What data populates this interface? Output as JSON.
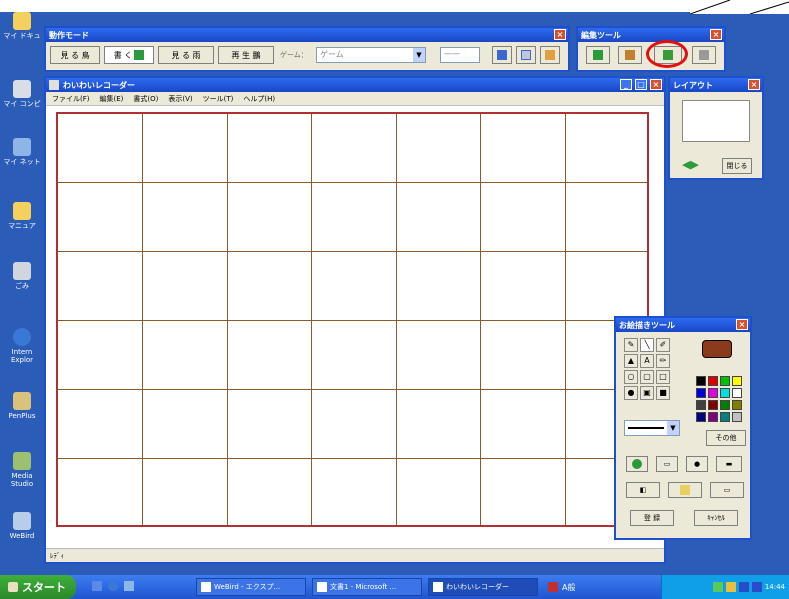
{
  "desktop": {
    "icons": [
      {
        "label": "マイ ドキュ",
        "color": "#f3d15c"
      },
      {
        "label": "マイ コンピ",
        "color": "#d9dde8"
      },
      {
        "label": "マイ ネット",
        "color": "#8fb4e6"
      },
      {
        "label": "マニュア",
        "color": "#f3d15c"
      },
      {
        "label": "ごみ",
        "color": "#cfd6de"
      },
      {
        "label": "Intern Explor",
        "color": "#3a78d8"
      },
      {
        "label": "PenPlus",
        "color": "#d9c27a"
      },
      {
        "label": "Media Studio",
        "color": "#9cc070"
      },
      {
        "label": "WeBird",
        "color": "#b8cde8"
      }
    ]
  },
  "mode_toolbar": {
    "title": "動作モード",
    "buttons": [
      "見 る 鳥",
      "書 く",
      "見 る 雨",
      "再 生 鵬"
    ],
    "game_label": "ゲーム：",
    "game_combo_value": "ゲーム",
    "small_combo_value": "一一",
    "icon_buttons": [
      "film-icon",
      "grid-icon",
      "user-icon"
    ]
  },
  "edit_tools": {
    "title": "編集ツール",
    "buttons": [
      "tree-icon",
      "stamp-icon",
      "paint-icon",
      "copy-icon"
    ]
  },
  "main_window": {
    "title": "わいわいレコーダー",
    "menu": [
      "ファイル(F)",
      "編集(E)",
      "書式(O)",
      "表示(V)",
      "ツール(T)",
      "ヘルプ(H)"
    ],
    "status": "ﾚﾃﾞｨ"
  },
  "preview_panel": {
    "title": "レイアウト",
    "close_label": "閉じる"
  },
  "paint_tools": {
    "title": "お絵描きツール",
    "more_colors_label": "その他",
    "cancel_label": "ｷｬﾝｾﾙ",
    "register_label": "登 録",
    "colors": [
      "#000000",
      "#e00000",
      "#00c000",
      "#ffff00",
      "#0000e0",
      "#e000e0",
      "#00e0e0",
      "#ffffff",
      "#404040",
      "#800000",
      "#008000",
      "#808000",
      "#000080",
      "#800080",
      "#008080",
      "#c0c0c0"
    ],
    "current_fg": "#8b3a1a",
    "current_bg": "#e00000"
  },
  "taskbar": {
    "start_label": "スタート",
    "tasks": [
      "WeBird - エクスプ...",
      "文書1 - Microsoft ...",
      "わいわいレコーダー"
    ],
    "ime": "A般",
    "clock": "14:44"
  }
}
